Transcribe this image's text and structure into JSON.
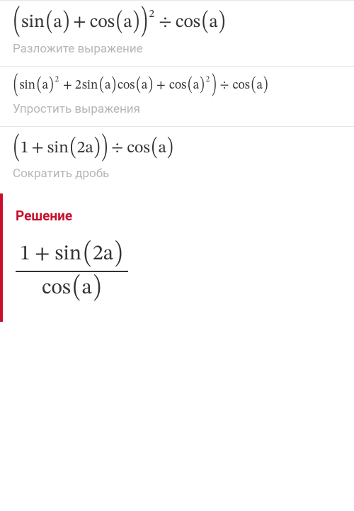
{
  "steps": [
    {
      "expr_parts": {
        "p1": "sin",
        "p2": "a",
        "p3": "cos",
        "p4": "a",
        "exp": "2",
        "p5": "cos",
        "p6": "a",
        "plus": "+",
        "div": "÷"
      },
      "hint": "Разложите выражение"
    },
    {
      "expr_parts": {
        "p1": "sin",
        "p2": "a",
        "e1": "2",
        "p3": "2",
        "p4": "sin",
        "p5": "a",
        "p6": "cos",
        "p7": "a",
        "p8": "cos",
        "p9": "a",
        "e2": "2",
        "p10": "cos",
        "p11": "a",
        "plus": "+",
        "div": "÷"
      },
      "hint": "Упростить выражения"
    },
    {
      "expr_parts": {
        "p1": "1",
        "p2": "sin",
        "p3": "2a",
        "p4": "cos",
        "p5": "a",
        "plus": "+",
        "div": "÷"
      },
      "hint": "Сократить дробь"
    }
  ],
  "solution": {
    "title": "Решение",
    "num": {
      "a": "1",
      "plus": "+",
      "b": "sin",
      "c": "2a"
    },
    "den": {
      "a": "cos",
      "b": "a"
    }
  },
  "chart_data": {
    "type": "table",
    "title": "Step-by-step simplification",
    "rows": [
      {
        "expression": "(sin(a) + cos(a))^2 ÷ cos(a)",
        "instruction": "Разложите выражение"
      },
      {
        "expression": "(sin(a)^2 + 2 sin(a) cos(a) + cos(a)^2) ÷ cos(a)",
        "instruction": "Упростить выражения"
      },
      {
        "expression": "(1 + sin(2a)) ÷ cos(a)",
        "instruction": "Сократить дробь"
      }
    ],
    "solution": "(1 + sin(2a)) / cos(a)"
  }
}
